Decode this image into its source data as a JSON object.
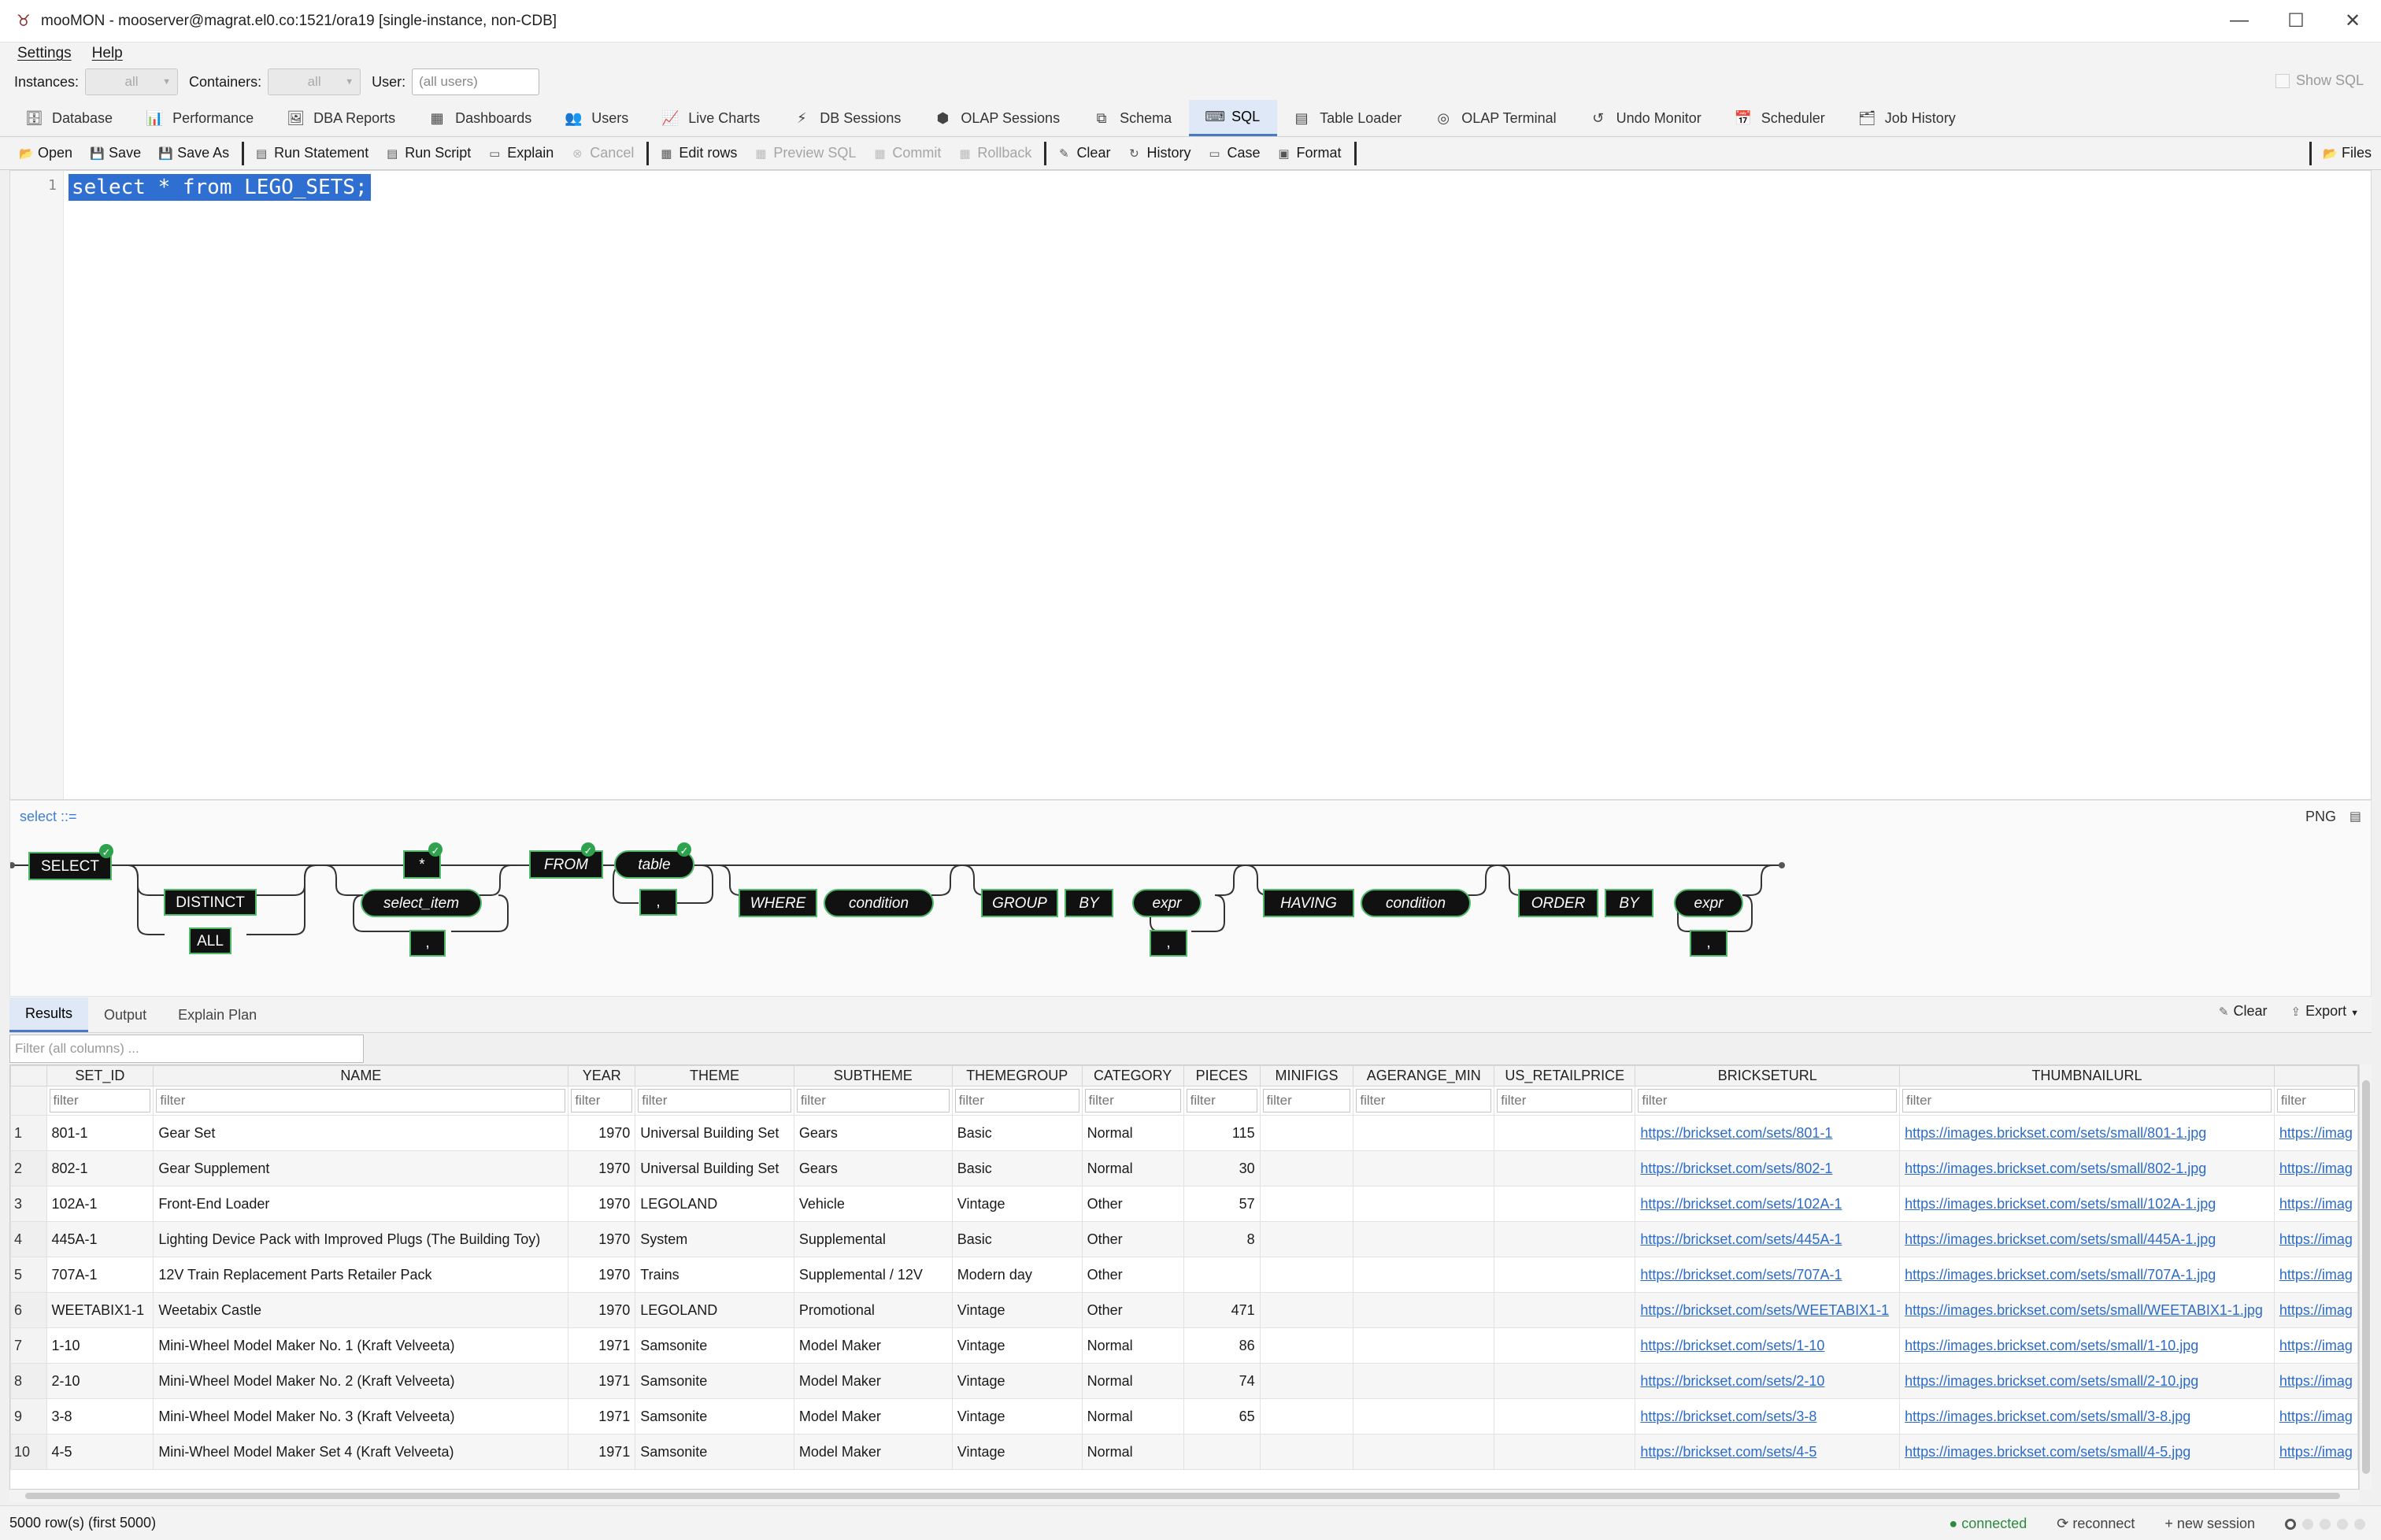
{
  "window": {
    "title": "mooMON - mooserver@magrat.el0.co:1521/ora19  [single-instance, non-CDB]",
    "minimize": "—",
    "maximize": "☐",
    "close": "✕"
  },
  "menu": {
    "items": [
      "Settings",
      "Help"
    ]
  },
  "filters": {
    "instances_label": "Instances:",
    "instances_value": "all",
    "containers_label": "Containers:",
    "containers_value": "all",
    "user_label": "User:",
    "user_placeholder": "(all users)",
    "show_sql": "Show SQL"
  },
  "nav_tabs": [
    {
      "label": "Database",
      "icon": "🗄"
    },
    {
      "label": "Performance",
      "icon": "📊"
    },
    {
      "label": "DBA Reports",
      "icon": "🖼"
    },
    {
      "label": "Dashboards",
      "icon": "▦"
    },
    {
      "label": "Users",
      "icon": "👥"
    },
    {
      "label": "Live Charts",
      "icon": "📈"
    },
    {
      "label": "DB Sessions",
      "icon": "⚡"
    },
    {
      "label": "OLAP Sessions",
      "icon": "⬢"
    },
    {
      "label": "Schema",
      "icon": "⧉"
    },
    {
      "label": "SQL",
      "icon": "⌨",
      "active": true
    },
    {
      "label": "Table Loader",
      "icon": "▤"
    },
    {
      "label": "OLAP Terminal",
      "icon": "◎"
    },
    {
      "label": "Undo Monitor",
      "icon": "↺"
    },
    {
      "label": "Scheduler",
      "icon": "📅"
    },
    {
      "label": "Job History",
      "icon": "🗂"
    }
  ],
  "toolbar": {
    "open": "Open",
    "save": "Save",
    "save_as": "Save As",
    "run_statement": "Run Statement",
    "run_script": "Run Script",
    "explain": "Explain",
    "cancel": "Cancel",
    "edit_rows": "Edit rows",
    "preview_sql": "Preview SQL",
    "commit": "Commit",
    "rollback": "Rollback",
    "clear": "Clear",
    "history": "History",
    "case": "Case",
    "format": "Format",
    "files": "Files"
  },
  "editor": {
    "line_number": "1",
    "code": "select * from LEGO_SETS;"
  },
  "railroad": {
    "label": "select ::=",
    "png": "PNG",
    "tokens": {
      "select": "SELECT",
      "distinct": "DISTINCT",
      "all": "ALL",
      "star": "*",
      "select_item": "select_item",
      "comma1": ",",
      "from": "FROM",
      "table": "table",
      "comma2": ",",
      "where": "WHERE",
      "condition1": "condition",
      "group": "GROUP",
      "by1": "BY",
      "expr1": "expr",
      "comma3": ",",
      "having": "HAVING",
      "condition2": "condition",
      "order": "ORDER",
      "by2": "BY",
      "expr2": "expr",
      "comma4": ","
    }
  },
  "results": {
    "tabs": [
      "Results",
      "Output",
      "Explain Plan"
    ],
    "clear": "Clear",
    "export": "Export",
    "filter_all_placeholder": "Filter (all columns) ...",
    "filter_placeholder": "filter",
    "columns": [
      "SET_ID",
      "NAME",
      "YEAR",
      "THEME",
      "SUBTHEME",
      "THEMEGROUP",
      "CATEGORY",
      "PIECES",
      "MINIFIGS",
      "AGERANGE_MIN",
      "US_RETAILPRICE",
      "BRICKSETURL",
      "THUMBNAILURL",
      ""
    ],
    "rows": [
      [
        "1",
        "801-1",
        "Gear Set",
        "1970",
        "Universal Building Set",
        "Gears",
        "Basic",
        "Normal",
        "115",
        "",
        "",
        "",
        "https://brickset.com/sets/801-1",
        "https://images.brickset.com/sets/small/801-1.jpg",
        "https://imag"
      ],
      [
        "2",
        "802-1",
        "Gear Supplement",
        "1970",
        "Universal Building Set",
        "Gears",
        "Basic",
        "Normal",
        "30",
        "",
        "",
        "",
        "https://brickset.com/sets/802-1",
        "https://images.brickset.com/sets/small/802-1.jpg",
        "https://imag"
      ],
      [
        "3",
        "102A-1",
        "Front-End Loader",
        "1970",
        "LEGOLAND",
        "Vehicle",
        "Vintage",
        "Other",
        "57",
        "",
        "",
        "",
        "https://brickset.com/sets/102A-1",
        "https://images.brickset.com/sets/small/102A-1.jpg",
        "https://imag"
      ],
      [
        "4",
        "445A-1",
        "Lighting Device Pack with Improved Plugs (The Building Toy)",
        "1970",
        "System",
        "Supplemental",
        "Basic",
        "Other",
        "8",
        "",
        "",
        "",
        "https://brickset.com/sets/445A-1",
        "https://images.brickset.com/sets/small/445A-1.jpg",
        "https://imag"
      ],
      [
        "5",
        "707A-1",
        "12V Train Replacement Parts Retailer Pack",
        "1970",
        "Trains",
        "Supplemental / 12V",
        "Modern day",
        "Other",
        "",
        "",
        "",
        "",
        "https://brickset.com/sets/707A-1",
        "https://images.brickset.com/sets/small/707A-1.jpg",
        "https://imag"
      ],
      [
        "6",
        "WEETABIX1-1",
        "Weetabix Castle",
        "1970",
        "LEGOLAND",
        "Promotional",
        "Vintage",
        "Other",
        "471",
        "",
        "",
        "",
        "https://brickset.com/sets/WEETABIX1-1",
        "https://images.brickset.com/sets/small/WEETABIX1-1.jpg",
        "https://imag"
      ],
      [
        "7",
        "1-10",
        "Mini-Wheel Model Maker No. 1 (Kraft Velveeta)",
        "1971",
        "Samsonite",
        "Model Maker",
        "Vintage",
        "Normal",
        "86",
        "",
        "",
        "",
        "https://brickset.com/sets/1-10",
        "https://images.brickset.com/sets/small/1-10.jpg",
        "https://imag"
      ],
      [
        "8",
        "2-10",
        "Mini-Wheel Model Maker No. 2 (Kraft Velveeta)",
        "1971",
        "Samsonite",
        "Model Maker",
        "Vintage",
        "Normal",
        "74",
        "",
        "",
        "",
        "https://brickset.com/sets/2-10",
        "https://images.brickset.com/sets/small/2-10.jpg",
        "https://imag"
      ],
      [
        "9",
        "3-8",
        "Mini-Wheel Model Maker No. 3 (Kraft Velveeta)",
        "1971",
        "Samsonite",
        "Model Maker",
        "Vintage",
        "Normal",
        "65",
        "",
        "",
        "",
        "https://brickset.com/sets/3-8",
        "https://images.brickset.com/sets/small/3-8.jpg",
        "https://imag"
      ],
      [
        "10",
        "4-5",
        "Mini-Wheel Model Maker Set 4 (Kraft Velveeta)",
        "1971",
        "Samsonite",
        "Model Maker",
        "Vintage",
        "Normal",
        "",
        "",
        "",
        "",
        "https://brickset.com/sets/4-5",
        "https://images.brickset.com/sets/small/4-5.jpg",
        "https://imag"
      ]
    ]
  },
  "status": {
    "rows": "5000 row(s) (first 5000)",
    "connected": "● connected",
    "reconnect": "⟳ reconnect",
    "new_session": "+ new session"
  }
}
